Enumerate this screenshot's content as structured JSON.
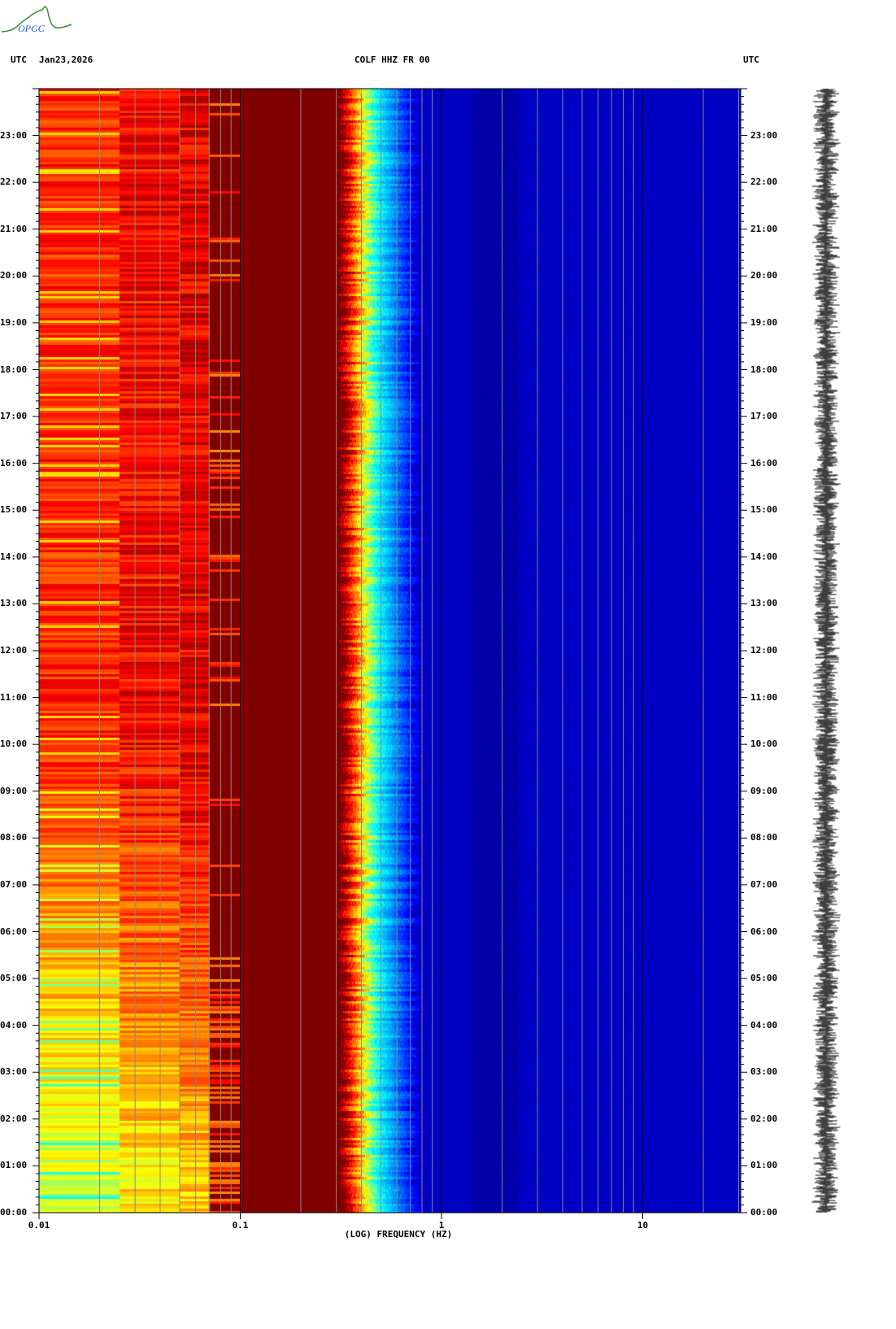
{
  "logo": {
    "text": "OPGC"
  },
  "header": {
    "left_tz": "UTC",
    "date": "Jan23,2026",
    "station": "COLF HHZ FR 00",
    "right_tz": "UTC"
  },
  "chart_data": {
    "type": "heatmap",
    "title": "COLF HHZ FR 00",
    "xlabel": "(LOG) FREQUENCY (HZ)",
    "ylabel": "UTC",
    "xscale": "log",
    "xlim": [
      0.01,
      30
    ],
    "ylim_hours": [
      0,
      24
    ],
    "x_tick_labels": [
      {
        "value": 0.01,
        "label": "0.01"
      },
      {
        "value": 0.1,
        "label": "0.1"
      },
      {
        "value": 1,
        "label": "1"
      },
      {
        "value": 10,
        "label": "10"
      }
    ],
    "y_tick_labels": [
      "00:00",
      "01:00",
      "02:00",
      "03:00",
      "04:00",
      "05:00",
      "06:00",
      "07:00",
      "08:00",
      "09:00",
      "10:00",
      "11:00",
      "12:00",
      "13:00",
      "14:00",
      "15:00",
      "16:00",
      "17:00",
      "18:00",
      "19:00",
      "20:00",
      "21:00",
      "22:00",
      "23:00"
    ],
    "colormap": "jet",
    "description_bands_hz": {
      "high_power": [
        0.01,
        0.3
      ],
      "transition": [
        0.3,
        0.8
      ],
      "low_power": [
        0.8,
        30
      ]
    }
  },
  "colors": {
    "grid_minor": "#888888",
    "grid_major": "#000000"
  }
}
